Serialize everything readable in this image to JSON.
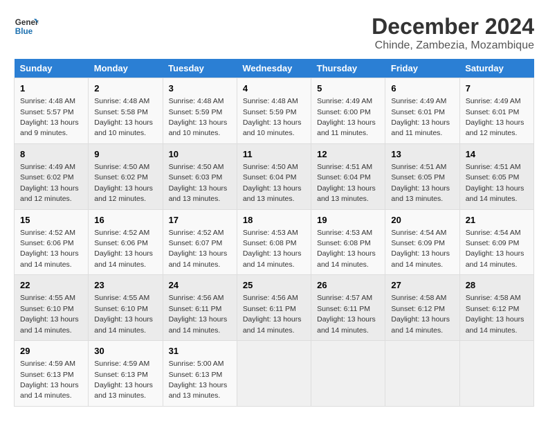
{
  "logo": {
    "line1": "General",
    "line2": "Blue"
  },
  "title": "December 2024",
  "subtitle": "Chinde, Zambezia, Mozambique",
  "days_of_week": [
    "Sunday",
    "Monday",
    "Tuesday",
    "Wednesday",
    "Thursday",
    "Friday",
    "Saturday"
  ],
  "weeks": [
    [
      {
        "day": "1",
        "info": "Sunrise: 4:48 AM\nSunset: 5:57 PM\nDaylight: 13 hours\nand 9 minutes."
      },
      {
        "day": "2",
        "info": "Sunrise: 4:48 AM\nSunset: 5:58 PM\nDaylight: 13 hours\nand 10 minutes."
      },
      {
        "day": "3",
        "info": "Sunrise: 4:48 AM\nSunset: 5:59 PM\nDaylight: 13 hours\nand 10 minutes."
      },
      {
        "day": "4",
        "info": "Sunrise: 4:48 AM\nSunset: 5:59 PM\nDaylight: 13 hours\nand 10 minutes."
      },
      {
        "day": "5",
        "info": "Sunrise: 4:49 AM\nSunset: 6:00 PM\nDaylight: 13 hours\nand 11 minutes."
      },
      {
        "day": "6",
        "info": "Sunrise: 4:49 AM\nSunset: 6:01 PM\nDaylight: 13 hours\nand 11 minutes."
      },
      {
        "day": "7",
        "info": "Sunrise: 4:49 AM\nSunset: 6:01 PM\nDaylight: 13 hours\nand 12 minutes."
      }
    ],
    [
      {
        "day": "8",
        "info": "Sunrise: 4:49 AM\nSunset: 6:02 PM\nDaylight: 13 hours\nand 12 minutes."
      },
      {
        "day": "9",
        "info": "Sunrise: 4:50 AM\nSunset: 6:02 PM\nDaylight: 13 hours\nand 12 minutes."
      },
      {
        "day": "10",
        "info": "Sunrise: 4:50 AM\nSunset: 6:03 PM\nDaylight: 13 hours\nand 13 minutes."
      },
      {
        "day": "11",
        "info": "Sunrise: 4:50 AM\nSunset: 6:04 PM\nDaylight: 13 hours\nand 13 minutes."
      },
      {
        "day": "12",
        "info": "Sunrise: 4:51 AM\nSunset: 6:04 PM\nDaylight: 13 hours\nand 13 minutes."
      },
      {
        "day": "13",
        "info": "Sunrise: 4:51 AM\nSunset: 6:05 PM\nDaylight: 13 hours\nand 13 minutes."
      },
      {
        "day": "14",
        "info": "Sunrise: 4:51 AM\nSunset: 6:05 PM\nDaylight: 13 hours\nand 14 minutes."
      }
    ],
    [
      {
        "day": "15",
        "info": "Sunrise: 4:52 AM\nSunset: 6:06 PM\nDaylight: 13 hours\nand 14 minutes."
      },
      {
        "day": "16",
        "info": "Sunrise: 4:52 AM\nSunset: 6:06 PM\nDaylight: 13 hours\nand 14 minutes."
      },
      {
        "day": "17",
        "info": "Sunrise: 4:52 AM\nSunset: 6:07 PM\nDaylight: 13 hours\nand 14 minutes."
      },
      {
        "day": "18",
        "info": "Sunrise: 4:53 AM\nSunset: 6:08 PM\nDaylight: 13 hours\nand 14 minutes."
      },
      {
        "day": "19",
        "info": "Sunrise: 4:53 AM\nSunset: 6:08 PM\nDaylight: 13 hours\nand 14 minutes."
      },
      {
        "day": "20",
        "info": "Sunrise: 4:54 AM\nSunset: 6:09 PM\nDaylight: 13 hours\nand 14 minutes."
      },
      {
        "day": "21",
        "info": "Sunrise: 4:54 AM\nSunset: 6:09 PM\nDaylight: 13 hours\nand 14 minutes."
      }
    ],
    [
      {
        "day": "22",
        "info": "Sunrise: 4:55 AM\nSunset: 6:10 PM\nDaylight: 13 hours\nand 14 minutes."
      },
      {
        "day": "23",
        "info": "Sunrise: 4:55 AM\nSunset: 6:10 PM\nDaylight: 13 hours\nand 14 minutes."
      },
      {
        "day": "24",
        "info": "Sunrise: 4:56 AM\nSunset: 6:11 PM\nDaylight: 13 hours\nand 14 minutes."
      },
      {
        "day": "25",
        "info": "Sunrise: 4:56 AM\nSunset: 6:11 PM\nDaylight: 13 hours\nand 14 minutes."
      },
      {
        "day": "26",
        "info": "Sunrise: 4:57 AM\nSunset: 6:11 PM\nDaylight: 13 hours\nand 14 minutes."
      },
      {
        "day": "27",
        "info": "Sunrise: 4:58 AM\nSunset: 6:12 PM\nDaylight: 13 hours\nand 14 minutes."
      },
      {
        "day": "28",
        "info": "Sunrise: 4:58 AM\nSunset: 6:12 PM\nDaylight: 13 hours\nand 14 minutes."
      }
    ],
    [
      {
        "day": "29",
        "info": "Sunrise: 4:59 AM\nSunset: 6:13 PM\nDaylight: 13 hours\nand 14 minutes."
      },
      {
        "day": "30",
        "info": "Sunrise: 4:59 AM\nSunset: 6:13 PM\nDaylight: 13 hours\nand 13 minutes."
      },
      {
        "day": "31",
        "info": "Sunrise: 5:00 AM\nSunset: 6:13 PM\nDaylight: 13 hours\nand 13 minutes."
      },
      {
        "day": "",
        "info": ""
      },
      {
        "day": "",
        "info": ""
      },
      {
        "day": "",
        "info": ""
      },
      {
        "day": "",
        "info": ""
      }
    ]
  ]
}
